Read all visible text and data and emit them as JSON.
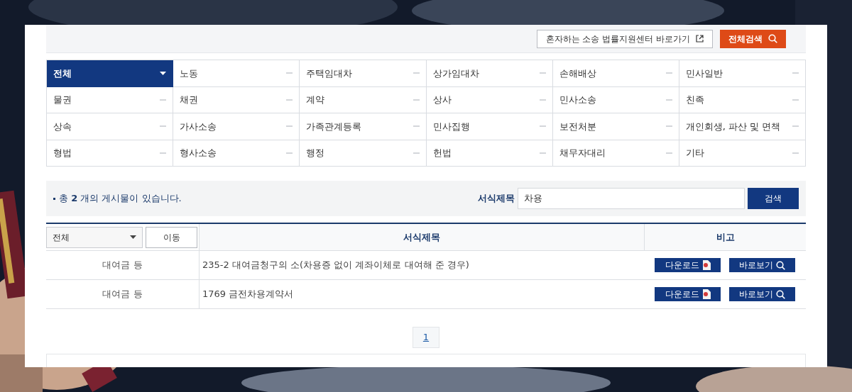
{
  "top_bar": {
    "link_button": "혼자하는 소송 법률지원센터 바로가기",
    "search_all_button": "전체검색"
  },
  "categories": [
    {
      "label": "전체",
      "selected": true
    },
    {
      "label": "노동",
      "selected": false
    },
    {
      "label": "주택임대차",
      "selected": false
    },
    {
      "label": "상가임대차",
      "selected": false
    },
    {
      "label": "손해배상",
      "selected": false
    },
    {
      "label": "민사일반",
      "selected": false
    },
    {
      "label": "물권",
      "selected": false
    },
    {
      "label": "채권",
      "selected": false
    },
    {
      "label": "계약",
      "selected": false
    },
    {
      "label": "상사",
      "selected": false
    },
    {
      "label": "민사소송",
      "selected": false
    },
    {
      "label": "친족",
      "selected": false
    },
    {
      "label": "상속",
      "selected": false
    },
    {
      "label": "가사소송",
      "selected": false
    },
    {
      "label": "가족관계등록",
      "selected": false
    },
    {
      "label": "민사집행",
      "selected": false
    },
    {
      "label": "보전처분",
      "selected": false
    },
    {
      "label": "개인회생, 파산 및 면책",
      "selected": false
    },
    {
      "label": "형법",
      "selected": false
    },
    {
      "label": "형사소송",
      "selected": false
    },
    {
      "label": "행정",
      "selected": false
    },
    {
      "label": "헌법",
      "selected": false
    },
    {
      "label": "채무자대리",
      "selected": false
    },
    {
      "label": "기타",
      "selected": false
    }
  ],
  "search_bar": {
    "result_text": "총 **2** 개의 게시물이 있습니다.",
    "field_label": "서식제목",
    "field_value": "차용",
    "button": "검색"
  },
  "table": {
    "filter_select": "전체",
    "move_button": "이동",
    "columns": [
      "서식제목",
      "비고"
    ],
    "rows": [
      {
        "category": "대여금 등",
        "title": "235-2 대여금청구의 소(차용증 없이 계좌이체로 대여해 준 경우)",
        "download": "다운로드",
        "view": "바로보기"
      },
      {
        "category": "대여금 등",
        "title": "1769 금전차용계약서",
        "download": "다운로드",
        "view": "바로보기"
      }
    ]
  },
  "pagination": [
    {
      "label": "1",
      "selected": true
    }
  ]
}
